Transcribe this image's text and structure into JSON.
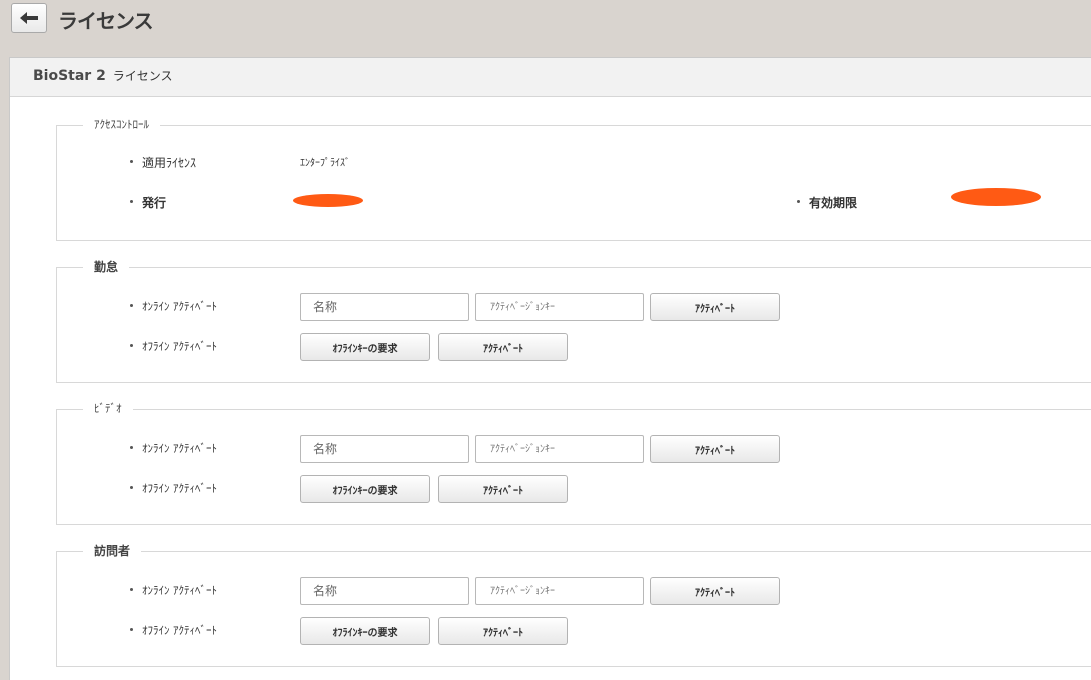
{
  "header": {
    "title": "ライセンス"
  },
  "panel": {
    "title_main": "BioStar 2",
    "title_sub": "ライセンス"
  },
  "access_control": {
    "legend": "ｱｸｾｽｺﾝﾄﾛｰﾙ",
    "applied_license_label": "適用ﾗｲｾﾝｽ",
    "applied_license_value": "ｴﾝﾀｰﾌﾟﾗｲｽﾞ",
    "issued_label": "発行",
    "expiry_label": "有効期限"
  },
  "sections": [
    {
      "legend": "勤怠",
      "online_label": "ｵﾝﾗｲﾝ ｱｸﾃｨﾍﾞｰﾄ",
      "offline_label": "ｵﾌﾗｲﾝ ｱｸﾃｨﾍﾞｰﾄ",
      "name_placeholder": "名称",
      "key_placeholder": "ｱｸﾃｨﾍﾞｰｼﾞｮﾝｷｰ",
      "activate_button": "ｱｸﾃｨﾍﾞｰﾄ",
      "offline_key_button": "ｵﾌﾗｲﾝｷｰの要求",
      "offline_activate_button": "ｱｸﾃｨﾍﾞｰﾄ"
    },
    {
      "legend": "ﾋﾞﾃﾞｵ",
      "online_label": "ｵﾝﾗｲﾝ ｱｸﾃｨﾍﾞｰﾄ",
      "offline_label": "ｵﾌﾗｲﾝ ｱｸﾃｨﾍﾞｰﾄ",
      "name_placeholder": "名称",
      "key_placeholder": "ｱｸﾃｨﾍﾞｰｼﾞｮﾝｷｰ",
      "activate_button": "ｱｸﾃｨﾍﾞｰﾄ",
      "offline_key_button": "ｵﾌﾗｲﾝｷｰの要求",
      "offline_activate_button": "ｱｸﾃｨﾍﾞｰﾄ"
    },
    {
      "legend": "訪問者",
      "online_label": "ｵﾝﾗｲﾝ ｱｸﾃｨﾍﾞｰﾄ",
      "offline_label": "ｵﾌﾗｲﾝ ｱｸﾃｨﾍﾞｰﾄ",
      "name_placeholder": "名称",
      "key_placeholder": "ｱｸﾃｨﾍﾞｰｼﾞｮﾝｷｰ",
      "activate_button": "ｱｸﾃｨﾍﾞｰﾄ",
      "offline_key_button": "ｵﾌﾗｲﾝｷｰの要求",
      "offline_activate_button": "ｱｸﾃｨﾍﾞｰﾄ"
    }
  ],
  "colors": {
    "background": "#d9d4cf",
    "redaction": "#ff5a14",
    "panel_header": "#f2f2f2"
  }
}
